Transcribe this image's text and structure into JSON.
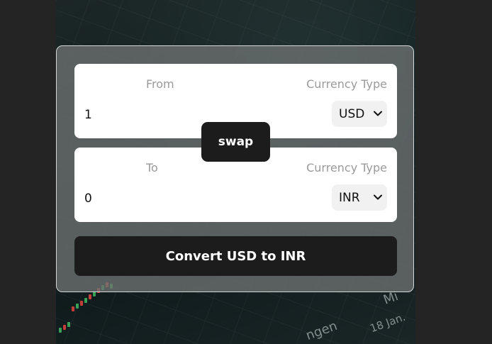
{
  "from": {
    "label": "From",
    "currency_type_label": "Currency Type",
    "amount": "1",
    "currency": "USD"
  },
  "to": {
    "label": "To",
    "currency_type_label": "Currency Type",
    "amount": "0",
    "currency": "INR"
  },
  "swap_label": "swap",
  "convert_label": "Convert USD to INR",
  "background_text": {
    "word": "ngen",
    "date": "18 Jan.",
    "fragment": "Mi"
  },
  "colors": {
    "page_bg": "#242424",
    "button_bg": "#1c1c1c",
    "label_gray": "#9a9a9a"
  }
}
